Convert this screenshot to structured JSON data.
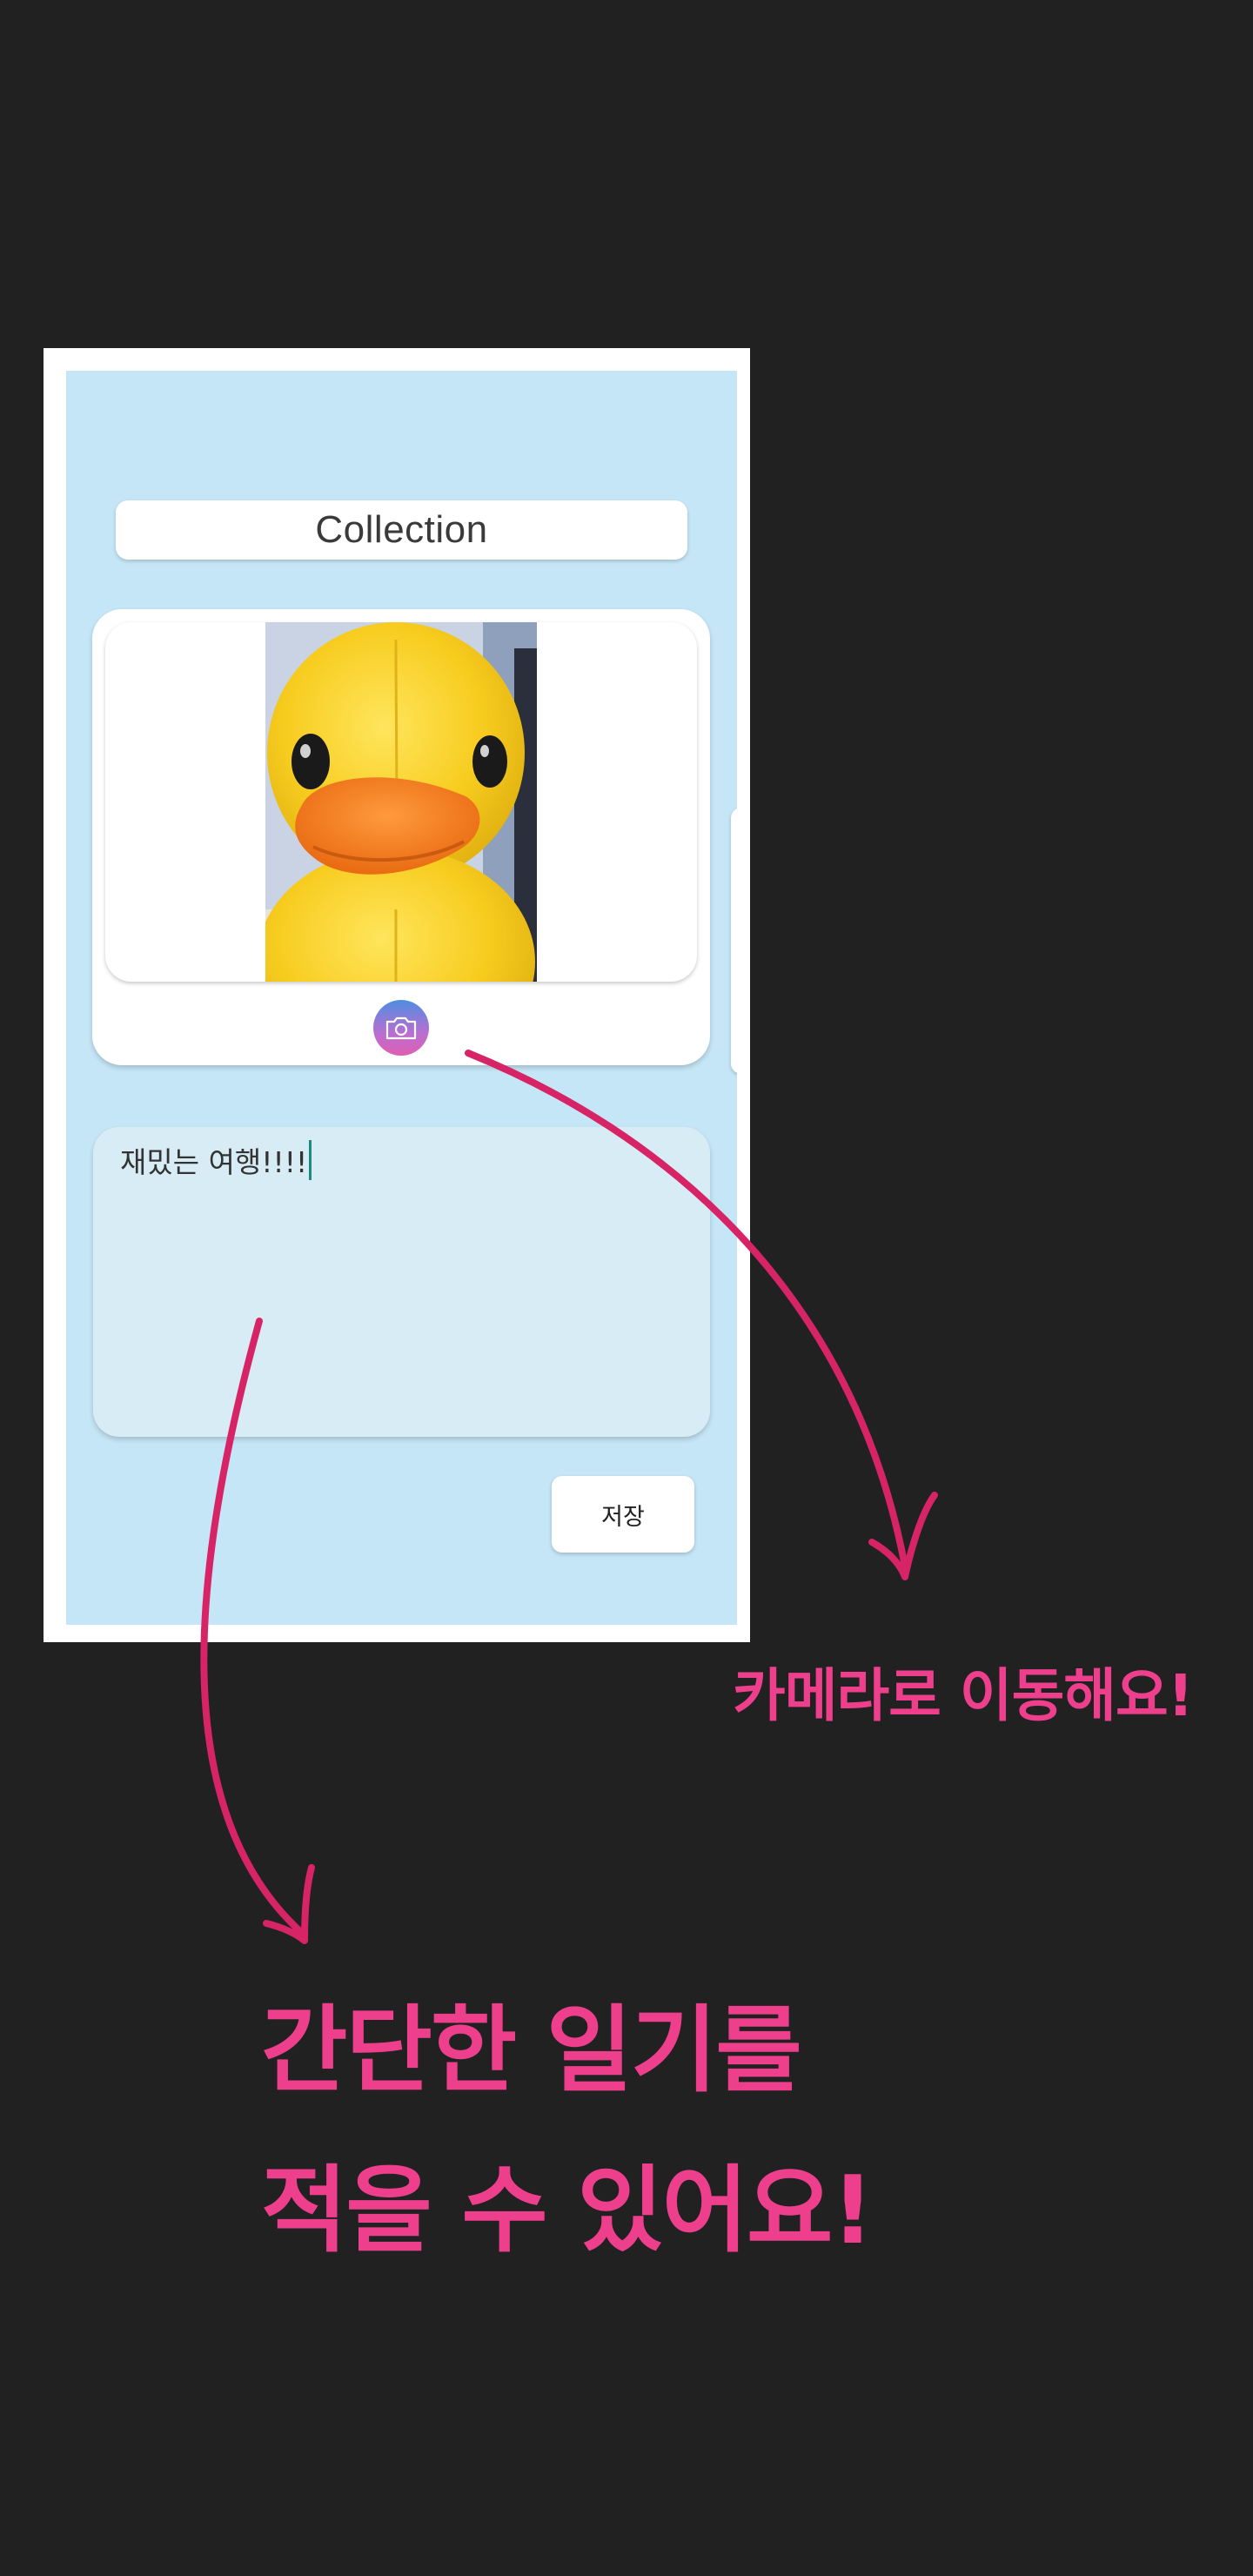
{
  "app": {
    "title": "Collection",
    "memo_text": "재밌는 여행!!!!",
    "save_label": "저장",
    "camera_icon": "camera-icon",
    "photo_subject": "yellow-duck-plush-photo"
  },
  "annotations": {
    "camera_callout": "카메라로 이동해요!",
    "diary_callout_line1": "간단한 일기를",
    "diary_callout_line2": "적을 수 있어요!",
    "accent_color": "#ee3f8d",
    "arrow_color": "#d62466"
  },
  "colors": {
    "page_background": "#212121",
    "app_background": "#c5e6f7",
    "memo_background": "#d8ecf5",
    "caret": "#1e8a7e"
  }
}
